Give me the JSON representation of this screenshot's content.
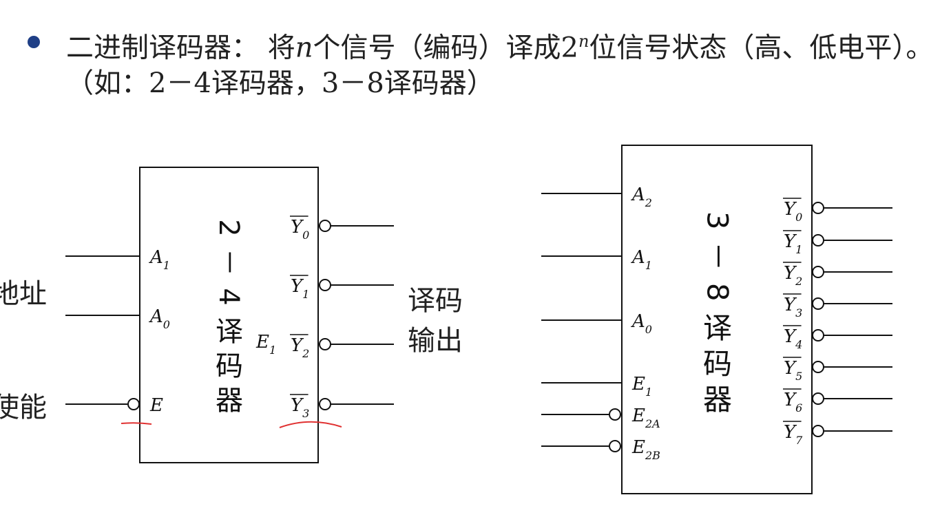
{
  "bullet": {
    "p1": "二进制译码器：  将",
    "n": "n",
    "p2": "个信号（编码）译成2",
    "sup": "n",
    "p3": "位信号状态（高、低电平）。（如：2－4译码器，3－8译码器）"
  },
  "dec24": {
    "title_chars": [
      "2",
      "－",
      "4",
      "译",
      "码",
      "器"
    ],
    "inputs": [
      {
        "name": "A",
        "sub": "1"
      },
      {
        "name": "A",
        "sub": "0"
      },
      {
        "name": "E",
        "sub": ""
      }
    ],
    "e1_label": "E",
    "e1_sub": "1",
    "outputs": [
      {
        "name": "Y",
        "sub": "0"
      },
      {
        "name": "Y",
        "sub": "1"
      },
      {
        "name": "Y",
        "sub": "2"
      },
      {
        "name": "Y",
        "sub": "3"
      }
    ],
    "side_address": "地址",
    "side_enable": "使能",
    "side_output_1": "译码",
    "side_output_2": "输出"
  },
  "dec38": {
    "title_chars": [
      "3",
      "－",
      "8",
      "译",
      "码",
      "器"
    ],
    "inputs": [
      {
        "name": "A",
        "sub": "2"
      },
      {
        "name": "A",
        "sub": "1"
      },
      {
        "name": "A",
        "sub": "0"
      },
      {
        "name": "E",
        "sub": "1"
      },
      {
        "name": "E",
        "sub": "2A"
      },
      {
        "name": "E",
        "sub": "2B"
      }
    ],
    "outputs": [
      {
        "name": "Y",
        "sub": "0"
      },
      {
        "name": "Y",
        "sub": "1"
      },
      {
        "name": "Y",
        "sub": "2"
      },
      {
        "name": "Y",
        "sub": "3"
      },
      {
        "name": "Y",
        "sub": "4"
      },
      {
        "name": "Y",
        "sub": "5"
      },
      {
        "name": "Y",
        "sub": "6"
      },
      {
        "name": "Y",
        "sub": "7"
      }
    ]
  },
  "colors": {
    "bullet": "#1f3f86",
    "annotation": "#e03030",
    "line": "#111111"
  }
}
